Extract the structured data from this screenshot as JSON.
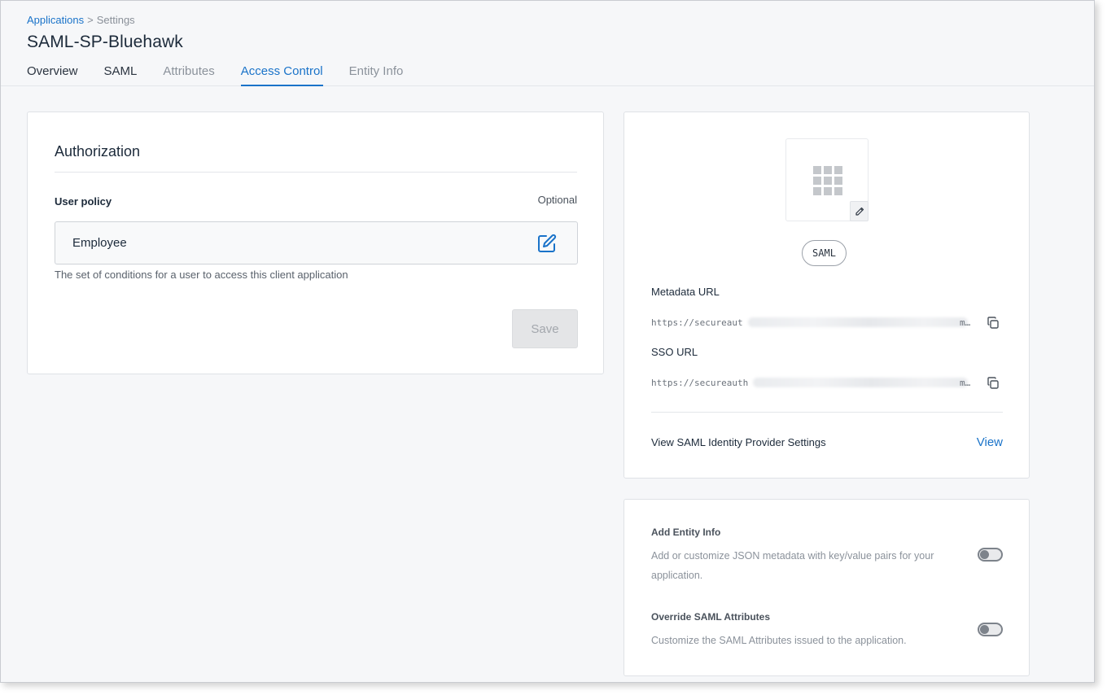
{
  "breadcrumb": {
    "parent": "Applications",
    "separator": ">",
    "current": "Settings"
  },
  "page_title": "SAML-SP-Bluehawk",
  "tabs": [
    {
      "label": "Overview",
      "state": "default"
    },
    {
      "label": "SAML",
      "state": "default"
    },
    {
      "label": "Attributes",
      "state": "muted"
    },
    {
      "label": "Access Control",
      "state": "active"
    },
    {
      "label": "Entity Info",
      "state": "muted"
    }
  ],
  "authorization": {
    "title": "Authorization",
    "user_policy_label": "User policy",
    "optional_label": "Optional",
    "policy_value": "Employee",
    "help_text": "The set of conditions for a user to access this client application",
    "save_label": "Save"
  },
  "saml_panel": {
    "badge": "SAML",
    "metadata_label": "Metadata URL",
    "metadata_url_visible": "https://secureaut",
    "sso_label": "SSO URL",
    "sso_url_visible": "https://secureauth",
    "url_suffix": "m…",
    "view_settings_label": "View SAML Identity Provider Settings",
    "view_link": "View"
  },
  "entity_panel": {
    "entity_info_title": "Add Entity Info",
    "entity_info_desc": "Add or customize JSON metadata with key/value pairs for your application.",
    "entity_info_enabled": false,
    "override_title": "Override SAML Attributes",
    "override_desc": "Customize the SAML Attributes issued to the application.",
    "override_enabled": false
  },
  "colors": {
    "accent": "#1a73c9",
    "background": "#f6f7f9",
    "text": "#1c2a3a"
  },
  "icons": {
    "policy_edit": "edit-square-icon",
    "logo_edit": "pencil-icon",
    "app_logo": "grid-icon",
    "copy": "copy-icon"
  }
}
